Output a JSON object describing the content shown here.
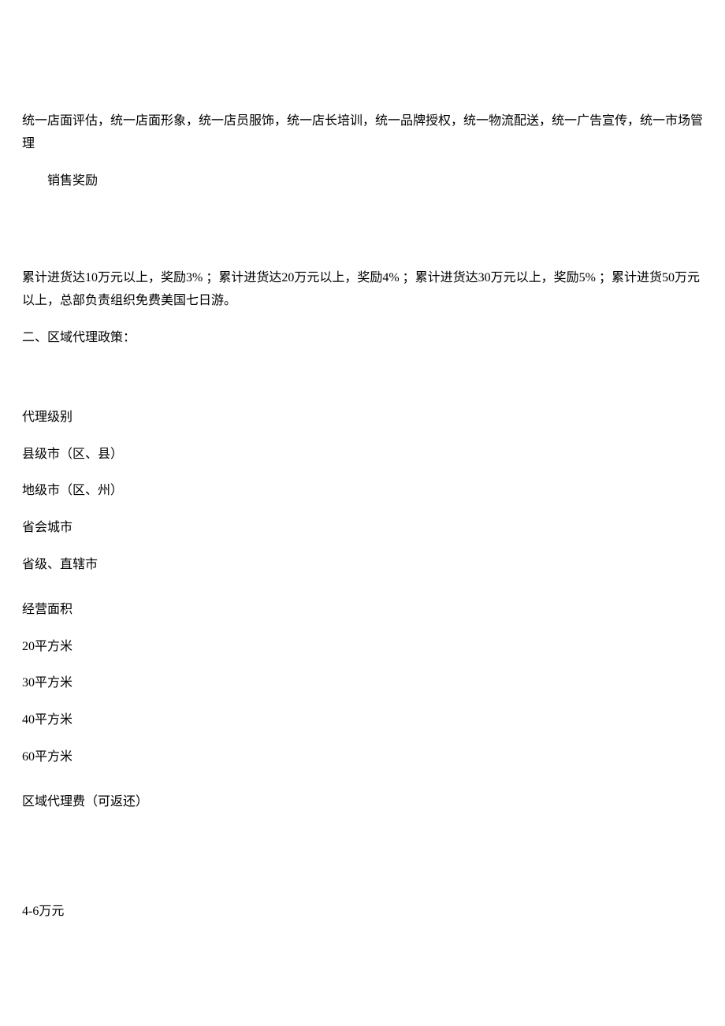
{
  "body": {
    "unified_policy": "统一店面评估，统一店面形象，统一店员服饰，统一店长培训，统一品牌授权，统一物流配送，统一广告宣传，统一市场管理",
    "sales_reward_title": "销售奖励",
    "sales_reward_detail": "累计进货达10万元以上，奖励3% ；累计进货达20万元以上，奖励4% ；累计进货达30万元以上，奖励5% ；累计进货50万元以上，总部负责组织免费美国七日游。",
    "regional_policy_title": "二、区域代理政策：",
    "agent_level_label": "代理级别",
    "agent_levels": [
      "县级市（区、县）",
      "地级市（区、州）",
      "省会城市",
      "省级、直辖市"
    ],
    "area_label": "经营面积",
    "areas": [
      "20平方米",
      "30平方米",
      "40平方米",
      "60平方米"
    ],
    "fee_label": "区域代理费（可返还）",
    "fee_value": "4-6万元"
  }
}
